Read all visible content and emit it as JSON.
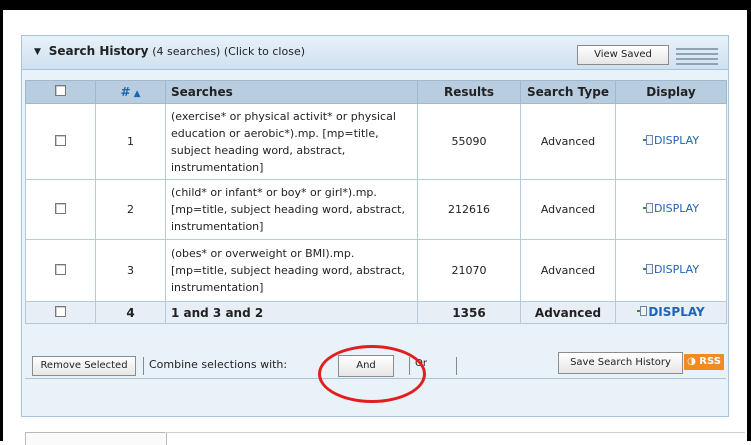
{
  "header": {
    "title": "Search History",
    "subtitle": "(4 searches)  (Click to close)",
    "view_saved_label": "View Saved"
  },
  "table": {
    "columns": {
      "select": "",
      "num": "#",
      "searches": "Searches",
      "results": "Results",
      "search_type": "Search Type",
      "display": "Display"
    },
    "rows": [
      {
        "num": "1",
        "search": "(exercise* or physical activit* or physical education or aerobic*).mp. [mp=title, subject heading word, abstract, instrumentation]",
        "results": "55090",
        "type": "Advanced",
        "display": "DISPLAY"
      },
      {
        "num": "2",
        "search": "(child* or infant* or boy* or girl*).mp. [mp=title, subject heading word, abstract, instrumentation]",
        "results": "212616",
        "type": "Advanced",
        "display": "DISPLAY"
      },
      {
        "num": "3",
        "search": "(obes* or overweight or BMI).mp. [mp=title, subject heading word, abstract, instrumentation]",
        "results": "21070",
        "type": "Advanced",
        "display": "DISPLAY"
      },
      {
        "num": "4",
        "search": "1 and 3 and 2",
        "results": "1356",
        "type": "Advanced",
        "display": "DISPLAY"
      }
    ]
  },
  "footer": {
    "remove_selected_label": "Remove Selected",
    "combine_label": "Combine selections with:",
    "and_label": "And",
    "or_label": "Or",
    "rss_label": "RSS",
    "save_history_label": "Save Search History"
  },
  "colors": {
    "panel_bg": "#eaf2f9",
    "header_row": "#b9cde0",
    "link": "#1f63b5",
    "rss": "#f18b20",
    "annotation_circle": "#e01f1f"
  }
}
